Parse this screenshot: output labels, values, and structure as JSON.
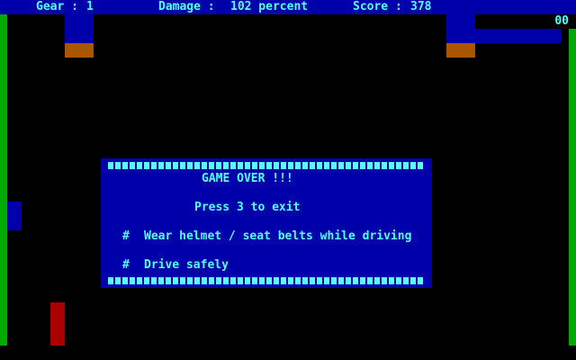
{
  "hud": {
    "gear_label": "Gear :",
    "gear_value": "1",
    "damage_label": "Damage :",
    "damage_value": "102 percent",
    "score_label": "Score :",
    "score_value": "378"
  },
  "corner_readout": "00",
  "dialog": {
    "title": "GAME OVER !!!",
    "exit_prompt": "Press 3 to exit",
    "tips": [
      {
        "bullet": "#",
        "text": "Wear helmet / seat belts while driving"
      },
      {
        "bullet": "#",
        "text": "Drive safely"
      }
    ]
  },
  "colors": {
    "hud_bg": "#0000AA",
    "text": "#55FFFF",
    "road_edge": "#00AA00",
    "car_body": "#0000AA",
    "car_wheel": "#AA5500",
    "player_car": "#AA0000",
    "background": "#000000"
  }
}
